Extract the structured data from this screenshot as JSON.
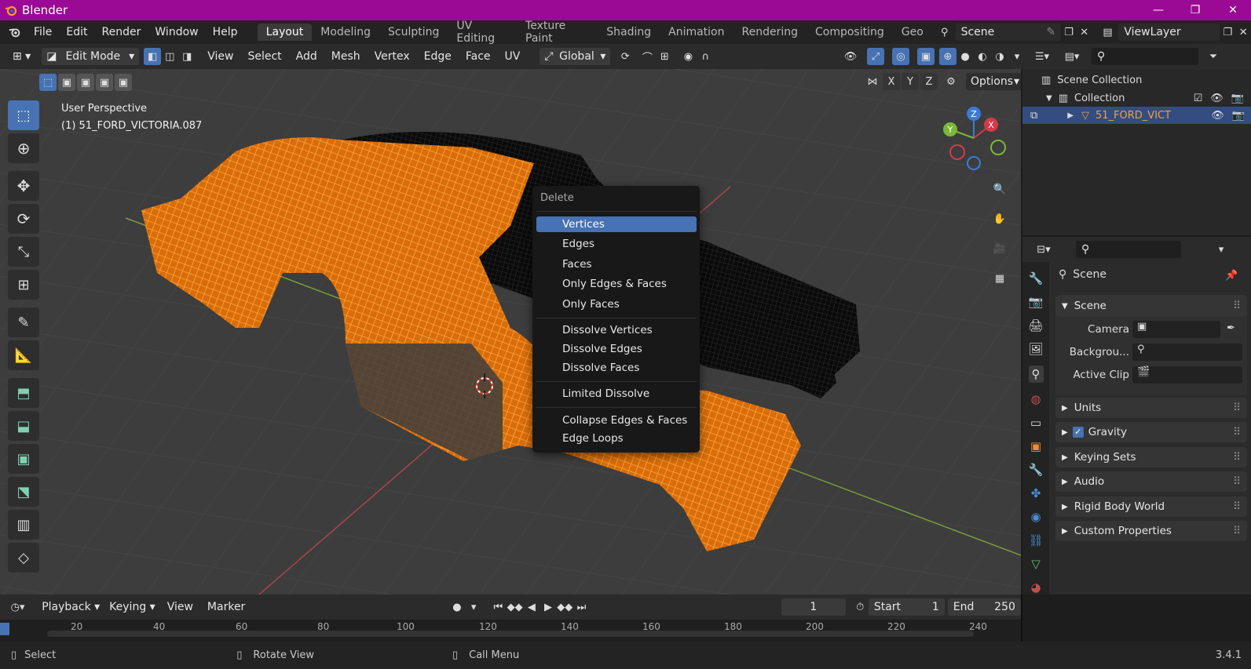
{
  "window": {
    "title": "Blender",
    "minimize": "—",
    "maximize": "❐",
    "close": "✕"
  },
  "menubar": {
    "menus": [
      "File",
      "Edit",
      "Render",
      "Window",
      "Help"
    ],
    "workspaces": [
      "Layout",
      "Modeling",
      "Sculpting",
      "UV Editing",
      "Texture Paint",
      "Shading",
      "Animation",
      "Rendering",
      "Compositing",
      "Geo"
    ],
    "active_workspace": "Layout",
    "scene_name": "Scene",
    "view_layer": "ViewLayer"
  },
  "view_header": {
    "mode": "Edit Mode",
    "menus": [
      "View",
      "Select",
      "Add",
      "Mesh",
      "Vertex",
      "Edge",
      "Face",
      "UV"
    ],
    "transform_orientation": "Global",
    "options_label": "Options",
    "axes": [
      "X",
      "Y",
      "Z"
    ]
  },
  "viewport": {
    "perspective_label": "User Perspective",
    "object_label": "(1) 51_FORD_VICTORIA.087",
    "gizmo": {
      "x": "X",
      "y": "Y",
      "z": "Z"
    }
  },
  "delete_menu": {
    "title": "Delete",
    "groups": [
      [
        "Vertices",
        "Edges",
        "Faces",
        "Only Edges & Faces",
        "Only Faces"
      ],
      [
        "Dissolve Vertices",
        "Dissolve Edges",
        "Dissolve Faces"
      ],
      [
        "Limited Dissolve"
      ],
      [
        "Collapse Edges & Faces",
        "Edge Loops"
      ]
    ],
    "highlighted": "Vertices"
  },
  "outliner": {
    "scene_collection": "Scene Collection",
    "collection": "Collection",
    "object": "51_FORD_VICT"
  },
  "properties": {
    "context": "Scene",
    "section": "Scene",
    "fields": [
      {
        "label": "Camera"
      },
      {
        "label": "Backgrou..."
      },
      {
        "label": "Active Clip"
      }
    ],
    "panels": [
      "Units",
      "Gravity",
      "Keying Sets",
      "Audio",
      "Rigid Body World",
      "Custom Properties"
    ]
  },
  "timeline": {
    "menus": [
      "Playback",
      "Keying",
      "View",
      "Marker"
    ],
    "current_frame": "1",
    "start_label": "Start",
    "start": "1",
    "end_label": "End",
    "end": "250",
    "ruler": [
      "20",
      "40",
      "60",
      "80",
      "100",
      "120",
      "140",
      "160",
      "180",
      "200",
      "220",
      "240"
    ]
  },
  "statusbar": {
    "select": "Select",
    "rotate": "Rotate View",
    "call_menu": "Call Menu",
    "version": "3.4.1"
  },
  "colors": {
    "accent": "#4772b3",
    "titlebar": "#9b0a94",
    "mesh_selected": "#ff8c1a",
    "mesh_unselected": "#111111"
  }
}
